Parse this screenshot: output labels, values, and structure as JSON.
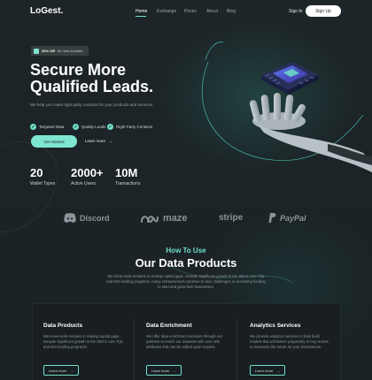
{
  "nav": {
    "logo": "LoGest.",
    "links": [
      "Home",
      "Exchange",
      "Prices",
      "About",
      "Blog"
    ],
    "sign_in": "Sign In",
    "sign_up": "Sign Up"
  },
  "hero": {
    "promo_badge": "20% Off",
    "promo_text": "for new member",
    "title_line1": "Secure More",
    "title_line2": "Qualified Leads.",
    "description": "We help you make right party contacts for your products and services.",
    "checks": [
      "Targeted Data",
      "Quality Leads",
      "Right Party Contacts"
    ],
    "primary_button": "Get Started",
    "secondary_button": "Learn more"
  },
  "stats": [
    {
      "value": "20",
      "label": "Wallet Types"
    },
    {
      "value": "2000+",
      "label": "Active Users"
    },
    {
      "value": "10M",
      "label": "Transactions"
    }
  ],
  "brands": [
    "Discord",
    "maze",
    "stripe",
    "PayPal"
  ],
  "section": {
    "kicker": "How To Use",
    "title": "Our Data Products",
    "description": "We know work remains in closing capital gaps. Despite significant growth in the SBA's core 7(a) and 504 lending programs, many entrepreneurs continue to face challenges in accessing funding to start and grow their businesses."
  },
  "cards": [
    {
      "title": "Data Products",
      "description": "We know work remains in closing capital gaps. Despite significant growth in the SBA's core 7(a) and 504 lending programs.",
      "button": "Learn more"
    },
    {
      "title": "Data Enrichment",
      "description": "We offer data enrichment services through our partners to enrich our datasets with over 400 attributes that can be added upon request.",
      "button": "Learn more"
    },
    {
      "title": "Analytics Services",
      "description": "We provide analytics services to help build models that will deliver propensity to buy scores to maximize the return on your investments.",
      "button": "Learn more"
    }
  ],
  "colors": {
    "accent": "#6fe0c8",
    "background": "#1e2428",
    "panel": "#181e21"
  }
}
